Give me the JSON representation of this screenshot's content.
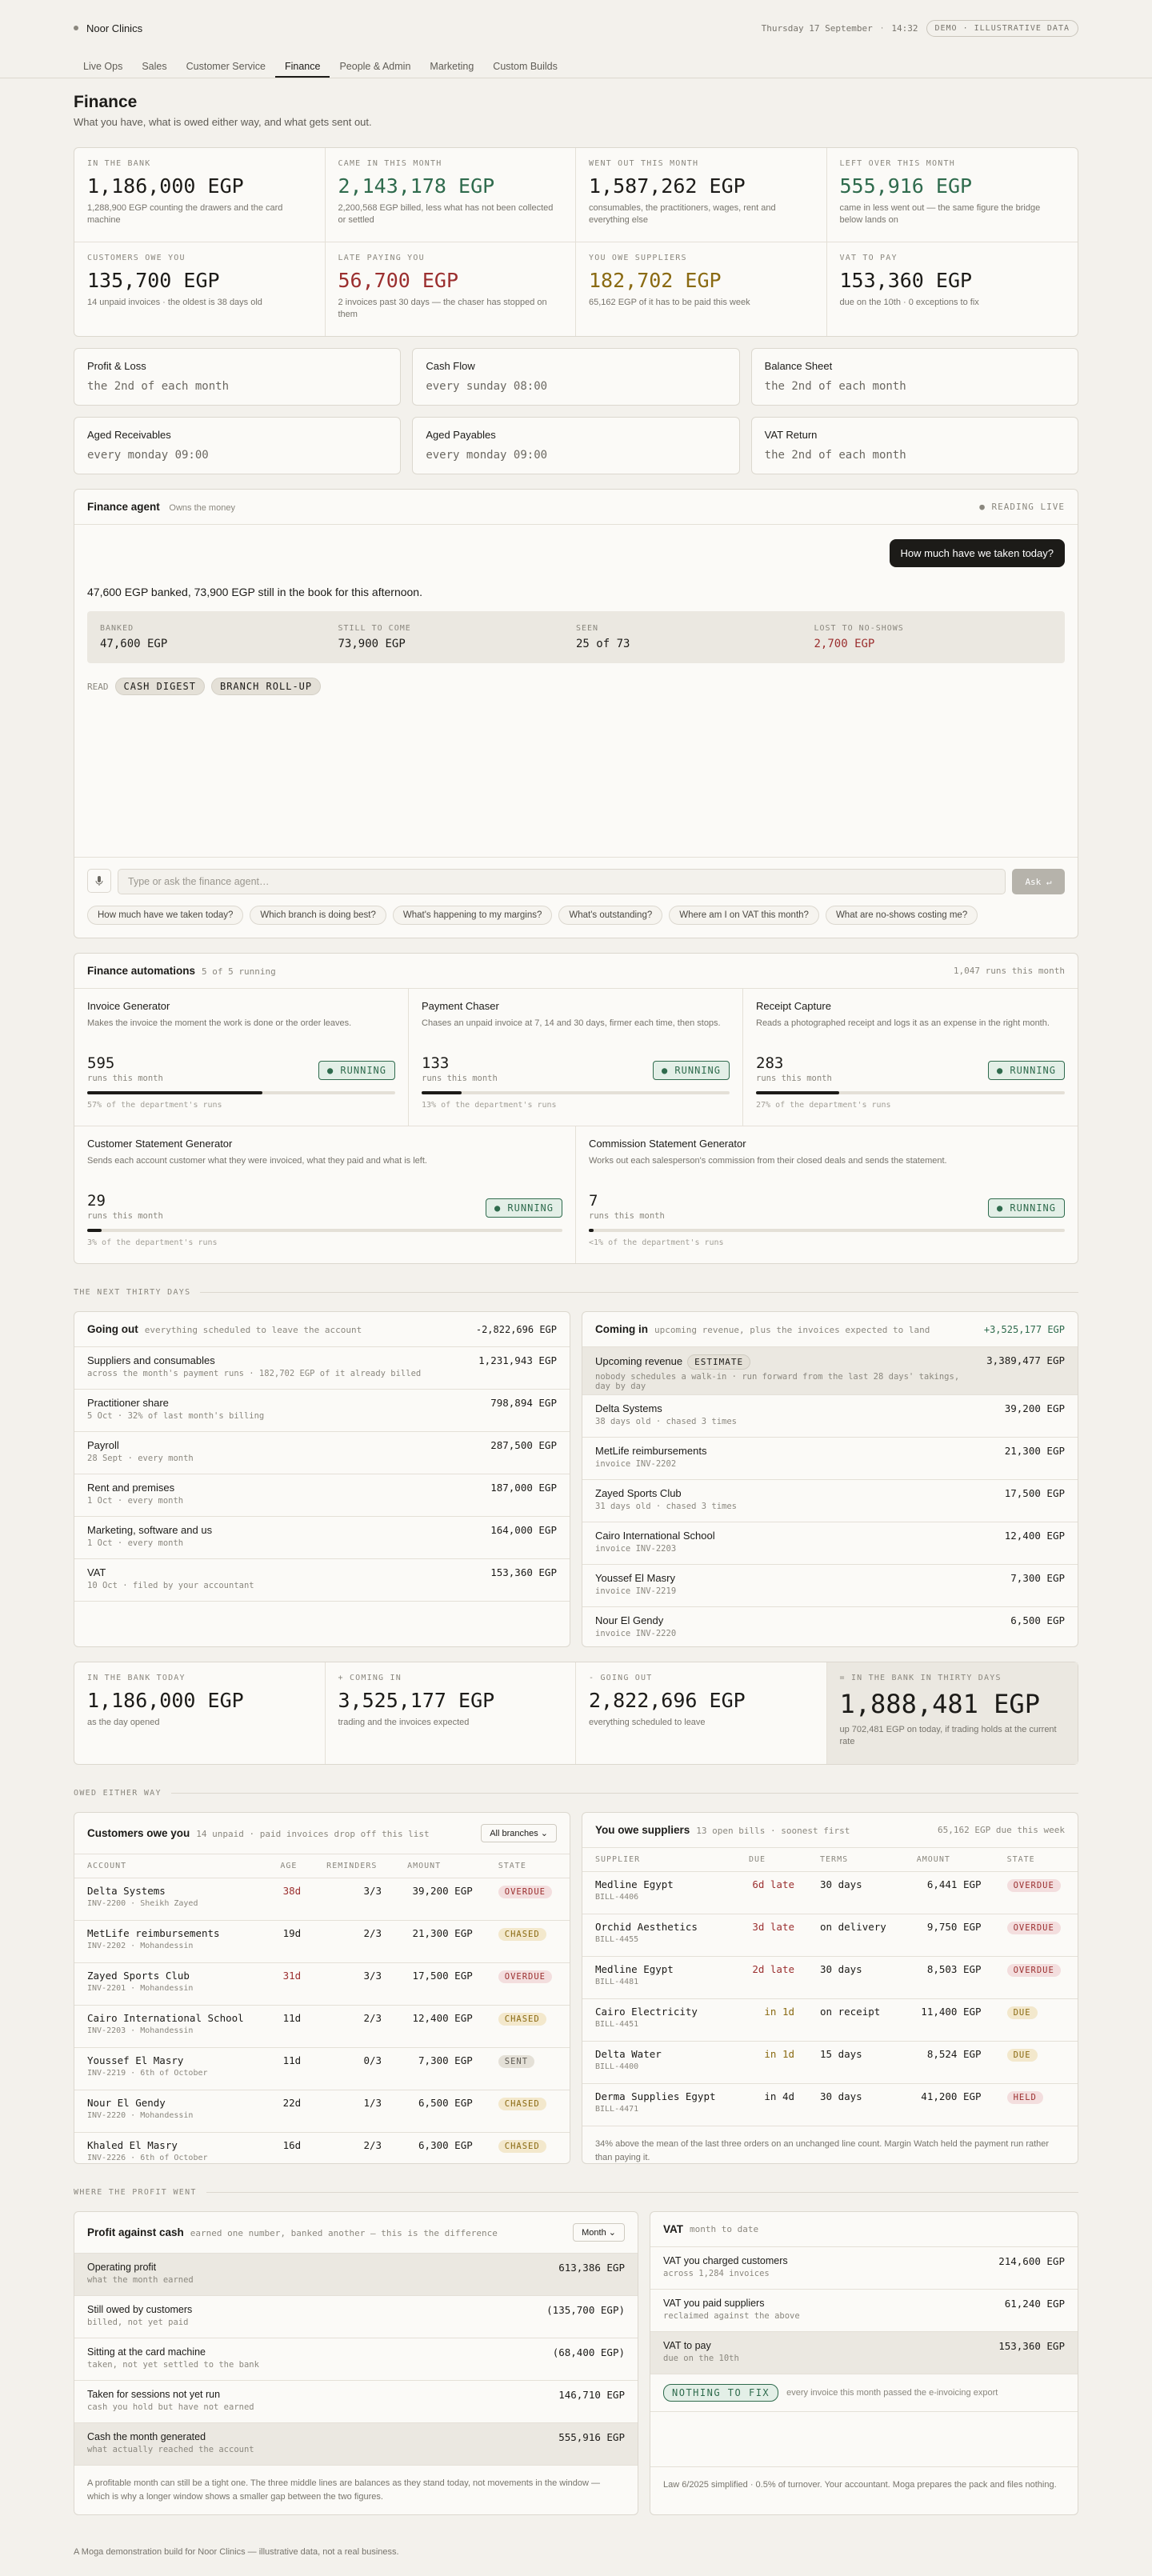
{
  "brand": "Noor Clinics",
  "date": "Thursday 17 September",
  "time": "14:32",
  "demo": "DEMO · ILLUSTRATIVE DATA",
  "tabs": [
    "Live Ops",
    "Sales",
    "Customer Service",
    "Finance",
    "People & Admin",
    "Marketing",
    "Custom Builds"
  ],
  "title": "Finance",
  "subtitle": "What you have, what is owed either way, and what gets sent out.",
  "kpis": [
    {
      "label": "IN THE BANK",
      "value": "1,186,000 EGP",
      "desc": "1,288,900 EGP counting the drawers and the card machine"
    },
    {
      "label": "CAME IN THIS MONTH",
      "value": "2,143,178 EGP",
      "desc": "2,200,568 EGP billed, less what has not been collected or settled"
    },
    {
      "label": "WENT OUT THIS MONTH",
      "value": "1,587,262 EGP",
      "desc": "consumables, the practitioners, wages, rent and everything else"
    },
    {
      "label": "LEFT OVER THIS MONTH",
      "value": "555,916 EGP",
      "desc": "came in less went out — the same figure the bridge below lands on"
    },
    {
      "label": "CUSTOMERS OWE YOU",
      "value": "135,700 EGP",
      "desc": "14 unpaid invoices · the oldest is 38 days old"
    },
    {
      "label": "LATE PAYING YOU",
      "value": "56,700 EGP",
      "desc": "2 invoices past 30 days — the chaser has stopped on them"
    },
    {
      "label": "YOU OWE SUPPLIERS",
      "value": "182,702 EGP",
      "desc": "65,162 EGP of it has to be paid this week"
    },
    {
      "label": "VAT TO PAY",
      "value": "153,360 EGP",
      "desc": "due on the 10th · 0 exceptions to fix"
    }
  ],
  "reports": [
    {
      "t": "Profit & Loss",
      "s": "the 2nd of each month"
    },
    {
      "t": "Cash Flow",
      "s": "every sunday 08:00"
    },
    {
      "t": "Balance Sheet",
      "s": "the 2nd of each month"
    },
    {
      "t": "Aged Receivables",
      "s": "every monday 09:00"
    },
    {
      "t": "Aged Payables",
      "s": "every monday 09:00"
    },
    {
      "t": "VAT Return",
      "s": "the 2nd of each month"
    }
  ],
  "agent": {
    "title": "Finance agent",
    "owns": "Owns the money",
    "status": "● READING LIVE",
    "question": "How much have we taken today?",
    "answer": "47,600 EGP banked, 73,900 EGP still in the book for this afternoon.",
    "grid": [
      {
        "l": "BANKED",
        "v": "47,600 EGP"
      },
      {
        "l": "STILL TO COME",
        "v": "73,900 EGP"
      },
      {
        "l": "SEEN",
        "v": "25 of 73"
      },
      {
        "l": "LOST TO NO-SHOWS",
        "v": "2,700 EGP"
      }
    ],
    "read_label": "READ",
    "read": [
      "CASH DIGEST",
      "BRANCH ROLL-UP"
    ],
    "placeholder": "Type or ask the finance agent…",
    "ask": "Ask ↵",
    "suggestions": [
      "How much have we taken today?",
      "Which branch is doing best?",
      "What's happening to my margins?",
      "What's outstanding?",
      "Where am I on VAT this month?",
      "What are no-shows costing me?"
    ]
  },
  "autos": {
    "title": "Finance automations",
    "count": "5 of 5 running",
    "runs": "1,047 runs this month",
    "items": [
      {
        "t": "Invoice Generator",
        "d": "Makes the invoice the moment the work is done or the order leaves.",
        "n": "595",
        "nl": "runs this month",
        "pct": 57,
        "bl": "57% of the department's runs"
      },
      {
        "t": "Payment Chaser",
        "d": "Chases an unpaid invoice at 7, 14 and 30 days, firmer each time, then stops.",
        "n": "133",
        "nl": "runs this month",
        "pct": 13,
        "bl": "13% of the department's runs"
      },
      {
        "t": "Receipt Capture",
        "d": "Reads a photographed receipt and logs it as an expense in the right month.",
        "n": "283",
        "nl": "runs this month",
        "pct": 27,
        "bl": "27% of the department's runs"
      },
      {
        "t": "Customer Statement Generator",
        "d": "Sends each account customer what they were invoiced, what they paid and what is left.",
        "n": "29",
        "nl": "runs this month",
        "pct": 3,
        "bl": "3% of the department's runs"
      },
      {
        "t": "Commission Statement Generator",
        "d": "Works out each salesperson's commission from their closed deals and sends the statement.",
        "n": "7",
        "nl": "runs this month",
        "pct": 1,
        "bl": "<1% of the department's runs"
      }
    ],
    "running": "● RUNNING"
  },
  "sect1": "THE NEXT THIRTY DAYS",
  "goingout": {
    "t": "Going out",
    "h": "everything scheduled to leave the account",
    "total": "-2,822,696 EGP",
    "rows": [
      {
        "a": "Suppliers and consumables",
        "b": "across the month's payment runs · 182,702 EGP of it already billed",
        "m": "1,231,943 EGP"
      },
      {
        "a": "Practitioner share",
        "b": "5 Oct · 32% of last month's billing",
        "m": "798,894 EGP"
      },
      {
        "a": "Payroll",
        "b": "28 Sept · every month",
        "m": "287,500 EGP"
      },
      {
        "a": "Rent and premises",
        "b": "1 Oct · every month",
        "m": "187,000 EGP"
      },
      {
        "a": "Marketing, software and us",
        "b": "1 Oct · every month",
        "m": "164,000 EGP"
      },
      {
        "a": "VAT",
        "b": "10 Oct · filed by your accountant",
        "m": "153,360 EGP"
      }
    ]
  },
  "comingin": {
    "t": "Coming in",
    "h": "upcoming revenue, plus the invoices expected to land",
    "total": "+3,525,177 EGP",
    "hl": {
      "a": "Upcoming revenue",
      "badge": "ESTIMATE",
      "b": "nobody schedules a walk-in · run forward from the last 28 days' takings, day by day",
      "m": "3,389,477 EGP"
    },
    "rows": [
      {
        "a": "Delta Systems",
        "b": "38 days old · chased 3 times",
        "m": "39,200 EGP"
      },
      {
        "a": "MetLife reimbursements",
        "b": "invoice INV-2202",
        "m": "21,300 EGP"
      },
      {
        "a": "Zayed Sports Club",
        "b": "31 days old · chased 3 times",
        "m": "17,500 EGP"
      },
      {
        "a": "Cairo International School",
        "b": "invoice INV-2203",
        "m": "12,400 EGP"
      },
      {
        "a": "Youssef El Masry",
        "b": "invoice INV-2219",
        "m": "7,300 EGP"
      },
      {
        "a": "Nour El Gendy",
        "b": "invoice INV-2220",
        "m": "6,500 EGP"
      }
    ]
  },
  "summary": [
    {
      "l": "IN THE BANK TODAY",
      "v": "1,186,000 EGP",
      "d": "as the day opened"
    },
    {
      "l": "+ COMING IN",
      "v": "3,525,177 EGP",
      "d": "trading and the invoices expected"
    },
    {
      "l": "- GOING OUT",
      "v": "2,822,696 EGP",
      "d": "everything scheduled to leave"
    },
    {
      "l": "= IN THE BANK IN THIRTY DAYS",
      "v": "1,888,481 EGP",
      "d": "up 702,481 EGP on today, if trading holds at the current rate"
    }
  ],
  "sect2": "OWED EITHER WAY",
  "custowe": {
    "t": "Customers owe you",
    "h": "14 unpaid · paid invoices drop off this list",
    "branches": "All branches ⌄",
    "cols": [
      "ACCOUNT",
      "AGE",
      "REMINDERS",
      "AMOUNT",
      "STATE"
    ],
    "rows": [
      {
        "a": "Delta Systems",
        "s": "INV-2200 · Sheikh Zayed",
        "age": "38d",
        "late": true,
        "rem": "3/3",
        "amt": "39,200 EGP",
        "st": "OVERDUE",
        "c": "ov"
      },
      {
        "a": "MetLife reimbursements",
        "s": "INV-2202 · Mohandessin",
        "age": "19d",
        "late": false,
        "rem": "2/3",
        "amt": "21,300 EGP",
        "st": "CHASED",
        "c": "ch"
      },
      {
        "a": "Zayed Sports Club",
        "s": "INV-2201 · Mohandessin",
        "age": "31d",
        "late": true,
        "rem": "3/3",
        "amt": "17,500 EGP",
        "st": "OVERDUE",
        "c": "ov"
      },
      {
        "a": "Cairo International School",
        "s": "INV-2203 · Mohandessin",
        "age": "11d",
        "late": false,
        "rem": "2/3",
        "amt": "12,400 EGP",
        "st": "CHASED",
        "c": "ch"
      },
      {
        "a": "Youssef El Masry",
        "s": "INV-2219 · 6th of October",
        "age": "11d",
        "late": false,
        "rem": "0/3",
        "amt": "7,300 EGP",
        "st": "SENT",
        "c": "se"
      },
      {
        "a": "Nour El Gendy",
        "s": "INV-2220 · Mohandessin",
        "age": "22d",
        "late": false,
        "rem": "1/3",
        "amt": "6,500 EGP",
        "st": "CHASED",
        "c": "ch"
      },
      {
        "a": "Khaled El Masry",
        "s": "INV-2226 · 6th of October",
        "age": "16d",
        "late": false,
        "rem": "2/3",
        "amt": "6,300 EGP",
        "st": "CHASED",
        "c": "ch"
      }
    ]
  },
  "youowe": {
    "t": "You owe suppliers",
    "h": "13 open bills · soonest first",
    "due": "65,162 EGP due this week",
    "cols": [
      "SUPPLIER",
      "DUE",
      "TERMS",
      "AMOUNT",
      "STATE"
    ],
    "rows": [
      {
        "a": "Medline Egypt",
        "s": "BILL-4406",
        "due": "6d late",
        "dc": "red",
        "terms": "30 days",
        "amt": "6,441 EGP",
        "st": "OVERDUE",
        "c": "ov"
      },
      {
        "a": "Orchid Aesthetics",
        "s": "BILL-4455",
        "due": "3d late",
        "dc": "red",
        "terms": "on delivery",
        "amt": "9,750 EGP",
        "st": "OVERDUE",
        "c": "ov"
      },
      {
        "a": "Medline Egypt",
        "s": "BILL-4481",
        "due": "2d late",
        "dc": "red",
        "terms": "30 days",
        "amt": "8,503 EGP",
        "st": "OVERDUE",
        "c": "ov"
      },
      {
        "a": "Cairo Electricity",
        "s": "BILL-4451",
        "due": "in 1d",
        "dc": "amber",
        "terms": "on receipt",
        "amt": "11,400 EGP",
        "st": "DUE",
        "c": "du"
      },
      {
        "a": "Delta Water",
        "s": "BILL-4400",
        "due": "in 1d",
        "dc": "amber",
        "terms": "15 days",
        "amt": "8,524 EGP",
        "st": "DUE",
        "c": "du"
      },
      {
        "a": "Derma Supplies Egypt",
        "s": "BILL-4471",
        "due": "in 4d",
        "dc": "",
        "terms": "30 days",
        "amt": "41,200 EGP",
        "st": "HELD",
        "c": "he"
      }
    ],
    "note": "34% above the mean of the last three orders on an unchanged line count. Margin Watch held the payment run rather than paying it."
  },
  "sect3": "WHERE THE PROFIT WENT",
  "profit": {
    "t": "Profit against cash",
    "h": "earned one number, banked another — this is the difference",
    "sel": "Month ⌄",
    "rows": [
      {
        "a": "Operating profit",
        "b": "what the month earned",
        "m": "613,386 EGP",
        "hl": true
      },
      {
        "a": "Still owed by customers",
        "b": "billed, not yet paid",
        "m": "(135,700 EGP)",
        "hl": false
      },
      {
        "a": "Sitting at the card machine",
        "b": "taken, not yet settled to the bank",
        "m": "(68,400 EGP)",
        "hl": false
      },
      {
        "a": "Taken for sessions not yet run",
        "b": "cash you hold but have not earned",
        "m": "146,710 EGP",
        "hl": false
      },
      {
        "a": "Cash the month generated",
        "b": "what actually reached the account",
        "m": "555,916 EGP",
        "hl": true
      }
    ],
    "note": "A profitable month can still be a tight one. The three middle lines are balances as they stand today, not movements in the window — which is why a longer window shows a smaller gap between the two figures."
  },
  "vat": {
    "t": "VAT",
    "h": "month to date",
    "rows": [
      {
        "a": "VAT you charged customers",
        "b": "across 1,284 invoices",
        "m": "214,600 EGP",
        "hl": false
      },
      {
        "a": "VAT you paid suppliers",
        "b": "reclaimed against the above",
        "m": "61,240 EGP",
        "hl": false
      },
      {
        "a": "VAT to pay",
        "b": "due on the 10th",
        "m": "153,360 EGP",
        "hl": true
      }
    ],
    "nf": "NOTHING TO FIX",
    "nft": "every invoice this month passed the e-invoicing export",
    "note": "Law 6/2025 simplified · 0.5% of turnover. Your accountant. Moga prepares the pack and files nothing."
  },
  "footer": "A Moga demonstration build for Noor Clinics — illustrative data, not a real business."
}
